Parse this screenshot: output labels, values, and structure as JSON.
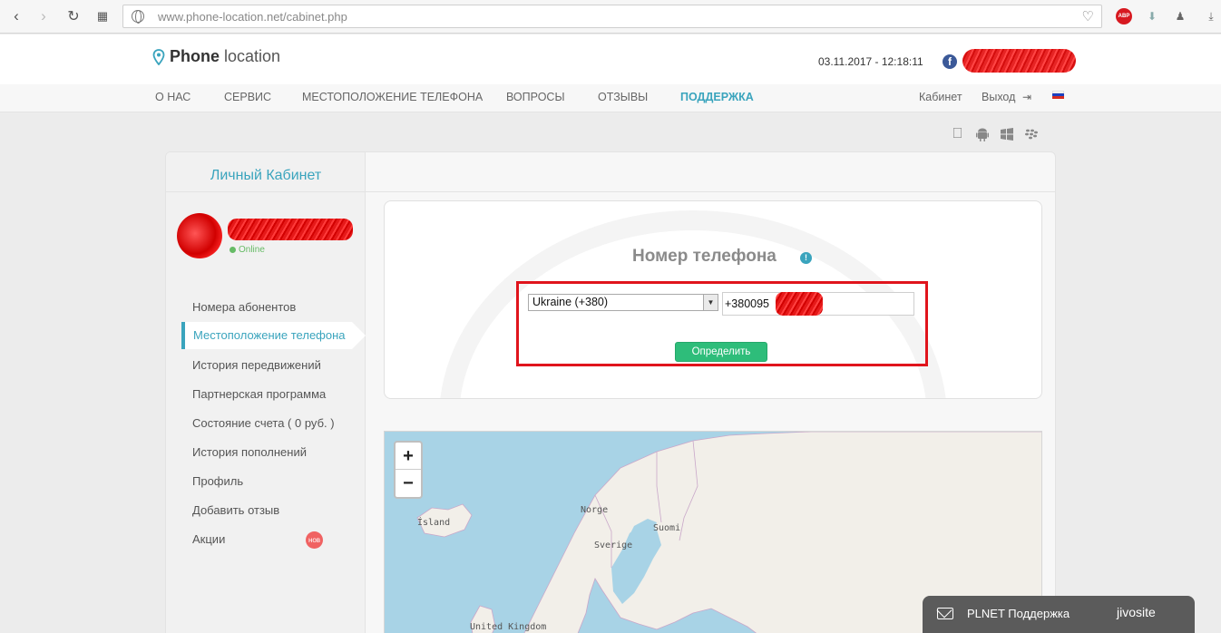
{
  "browser": {
    "url": "www.phone-location.net/cabinet.php",
    "icons": [
      "back-icon",
      "forward-icon",
      "reload-icon",
      "tabs-grid-icon",
      "globe-icon",
      "heart-icon",
      "adblock-icon",
      "download-arrow-icon",
      "hat-icon",
      "download-icon"
    ],
    "abp_label": "ABP"
  },
  "header": {
    "logo_main": "Phone",
    "logo_sub": "location",
    "datetime": "03.11.2017 - 12:18:11",
    "fb_label": "f"
  },
  "nav": {
    "items": [
      "О НАС",
      "СЕРВИС",
      "МЕСТОПОЛОЖЕНИЕ ТЕЛЕФОНА",
      "ВОПРОСЫ",
      "ОТЗЫВЫ",
      "ПОДДЕРЖКА"
    ],
    "active_index": 5,
    "cabinet": "Кабинет",
    "logout": "Выход"
  },
  "sidebar": {
    "title": "Личный Кабинет",
    "status": "Online",
    "items": [
      "Номера абонентов",
      "Местоположение телефона",
      "История передвижений",
      "Партнерская программа",
      "Состояние счета ( 0 руб. )",
      "История пополнений",
      "Профиль",
      "Добавить отзыв",
      "Акции"
    ],
    "active_index": 1,
    "new_badge": "нов"
  },
  "form": {
    "title": "Номер телефона",
    "info_symbol": "!",
    "country_selected": "Ukraine (+380)",
    "phone_value": "+380095",
    "submit_label": "Определить"
  },
  "map": {
    "zoom_in": "+",
    "zoom_out": "−",
    "labels": [
      "Ísland",
      "Norge",
      "Suomi",
      "Sverige",
      "United Kingdom"
    ]
  },
  "chat": {
    "label": "PLNET Поддержка",
    "brand": "jivosite"
  },
  "colors": {
    "accent": "#3aa4bd",
    "button_green": "#2ebd7a",
    "highlight_red": "#e0141c",
    "map_water": "#a8d3e6",
    "map_land": "#f2efe9"
  }
}
